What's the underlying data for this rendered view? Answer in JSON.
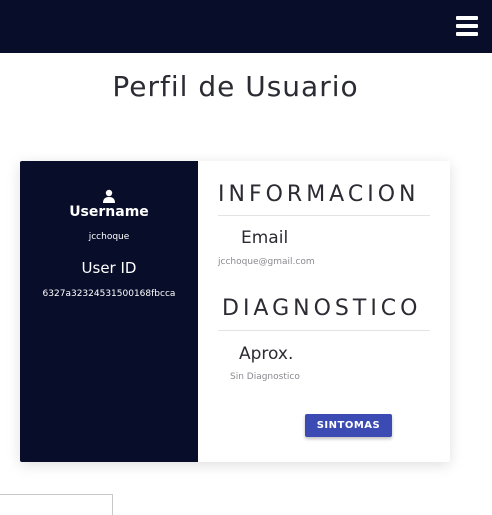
{
  "header": {
    "menu_icon": "hamburger-menu-icon",
    "background": "#080d2a"
  },
  "page_title": "Perfil de Usuario",
  "profile": {
    "user_icon": "user-icon",
    "username_label": "Username",
    "username_value": "jcchoque",
    "userid_label": "User ID",
    "userid_value": "6327a32324531500168fbcca"
  },
  "info": {
    "heading": "INFORMACION",
    "email_label": "Email",
    "email_value": "jcchoque@gmail.com"
  },
  "diagnostico": {
    "heading": "DIAGNOSTICO",
    "aprox_label": "Aprox.",
    "aprox_value": "Sin Diagnostico"
  },
  "actions": {
    "sintomas_label": "SINTOMAS"
  },
  "colors": {
    "navy": "#080d2a",
    "button": "#3b4bb3",
    "text": "#2b2b33"
  }
}
